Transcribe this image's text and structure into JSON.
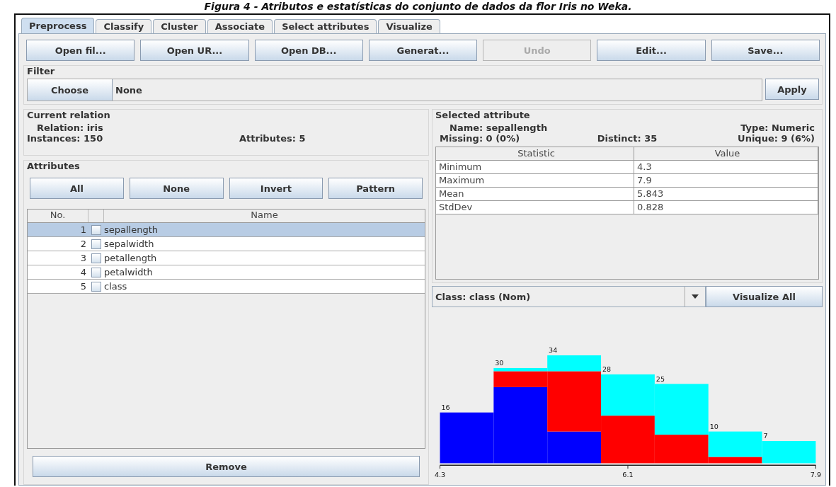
{
  "caption": "Figura 4 - Atributos e estatísticas do conjunto de dados da flor Iris no Weka.",
  "tabs": [
    {
      "label": "Preprocess",
      "selected": true
    },
    {
      "label": "Classify",
      "selected": false
    },
    {
      "label": "Cluster",
      "selected": false
    },
    {
      "label": "Associate",
      "selected": false
    },
    {
      "label": "Select attributes",
      "selected": false
    },
    {
      "label": "Visualize",
      "selected": false
    }
  ],
  "toolbar": [
    {
      "label": "Open fil...",
      "disabled": false
    },
    {
      "label": "Open UR...",
      "disabled": false
    },
    {
      "label": "Open DB...",
      "disabled": false
    },
    {
      "label": "Generat...",
      "disabled": false
    },
    {
      "label": "Undo",
      "disabled": true
    },
    {
      "label": "Edit...",
      "disabled": false
    },
    {
      "label": "Save...",
      "disabled": false
    }
  ],
  "filter": {
    "title": "Filter",
    "button": "Choose",
    "value": "None",
    "apply": "Apply"
  },
  "current_relation": {
    "title": "Current relation",
    "relation": "Relation: iris",
    "instances": "Instances: 150",
    "attributes": "Attributes: 5"
  },
  "attributes": {
    "title": "Attributes",
    "buttons": [
      "All",
      "None",
      "Invert",
      "Pattern"
    ],
    "columns": {
      "number": "No.",
      "name": "Name"
    },
    "rows": [
      {
        "no": "1",
        "name": "sepallength",
        "checked": false,
        "selected": true
      },
      {
        "no": "2",
        "name": "sepalwidth",
        "checked": false,
        "selected": false
      },
      {
        "no": "3",
        "name": "petallength",
        "checked": false,
        "selected": false
      },
      {
        "no": "4",
        "name": "petalwidth",
        "checked": false,
        "selected": false
      },
      {
        "no": "5",
        "name": "class",
        "checked": false,
        "selected": false
      }
    ],
    "remove": "Remove"
  },
  "selected_attribute": {
    "title": "Selected attribute",
    "name": "Name: sepallength",
    "type": "Type: Numeric",
    "missing": "Missing: 0 (0%)",
    "distinct": "Distinct: 35",
    "unique": "Unique: 9 (6%)",
    "columns": [
      "Statistic",
      "Value"
    ],
    "rows": [
      [
        "Minimum",
        "4.3"
      ],
      [
        "Maximum",
        "7.9"
      ],
      [
        "Mean",
        "5.843"
      ],
      [
        "StdDev",
        "0.828"
      ]
    ]
  },
  "class_selector": {
    "value": "Class: class (Nom)",
    "button": "Visualize All"
  },
  "histogram": {
    "bar_totals": [
      "16",
      "30",
      "34",
      "28",
      "25",
      "10",
      "7"
    ],
    "tick_labels": [
      "4.3",
      "6.1",
      "7.9"
    ]
  }
}
